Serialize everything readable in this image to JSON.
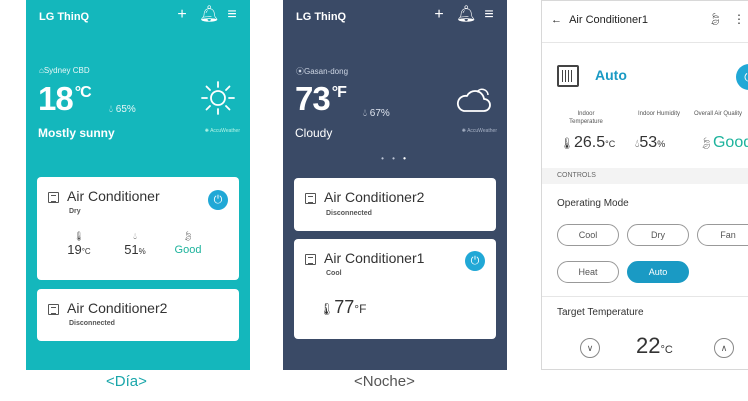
{
  "day": {
    "brand": "LG ThinQ",
    "location": "⌂Sydney CBD",
    "temperature": "18",
    "unit": "°C",
    "humidity": "65%",
    "condition": "Mostly sunny",
    "provider": "✺ AccuWeather",
    "devices": [
      {
        "name": "Air Conditioner",
        "mode": "Dry",
        "temp": "19",
        "temp_unit": "°C",
        "humidity": "51",
        "humidity_unit": "%",
        "air": "Good"
      },
      {
        "name": "Air Conditioner2",
        "status": "Disconnected"
      }
    ],
    "caption": "<Día>"
  },
  "night": {
    "brand": "LG ThinQ",
    "location": "⦿Gasan-dong",
    "temperature": "73",
    "unit": "°F",
    "humidity": "67%",
    "condition": "Cloudy",
    "provider": "✺ AccuWeather",
    "devices": [
      {
        "name": "Air Conditioner2",
        "status": "Disconnected"
      },
      {
        "name": "Air Conditioner1",
        "mode": "Cool",
        "temp": "77",
        "temp_unit": "°F"
      }
    ],
    "caption": "<Noche>"
  },
  "detail": {
    "title": "Air Conditioner1",
    "mode": "Auto",
    "indoor_temp_label": "Indoor Temperature",
    "indoor_humidity_label": "Indoor Humidity",
    "air_quality_label": "Overall Air Quality",
    "indoor_temp": "26.5",
    "indoor_temp_unit": "°C",
    "indoor_humidity": "53",
    "indoor_humidity_unit": "%",
    "air_quality": "Good",
    "section": "CONTROLS",
    "operating_mode_label": "Operating Mode",
    "modes": [
      "Cool",
      "Dry",
      "Fan",
      "Heat",
      "Auto"
    ],
    "selected_mode": "Auto",
    "target_label": "Target Temperature",
    "target_temp": "22",
    "target_unit": "°C"
  },
  "icons": {
    "add": "add-icon",
    "bell": "bell-icon",
    "menu": "menu-icon",
    "sun": "sun-icon",
    "cloud": "cloud-icon",
    "thermo": "thermometer-icon",
    "drop": "droplet-icon",
    "leaf": "leaf-icon",
    "power": "power-icon",
    "back": "back-arrow-icon"
  },
  "colors": {
    "day_bg": "#14b7bc",
    "night_bg": "#3a4a66",
    "accent": "#1a9ac4",
    "good": "#1db39c"
  }
}
